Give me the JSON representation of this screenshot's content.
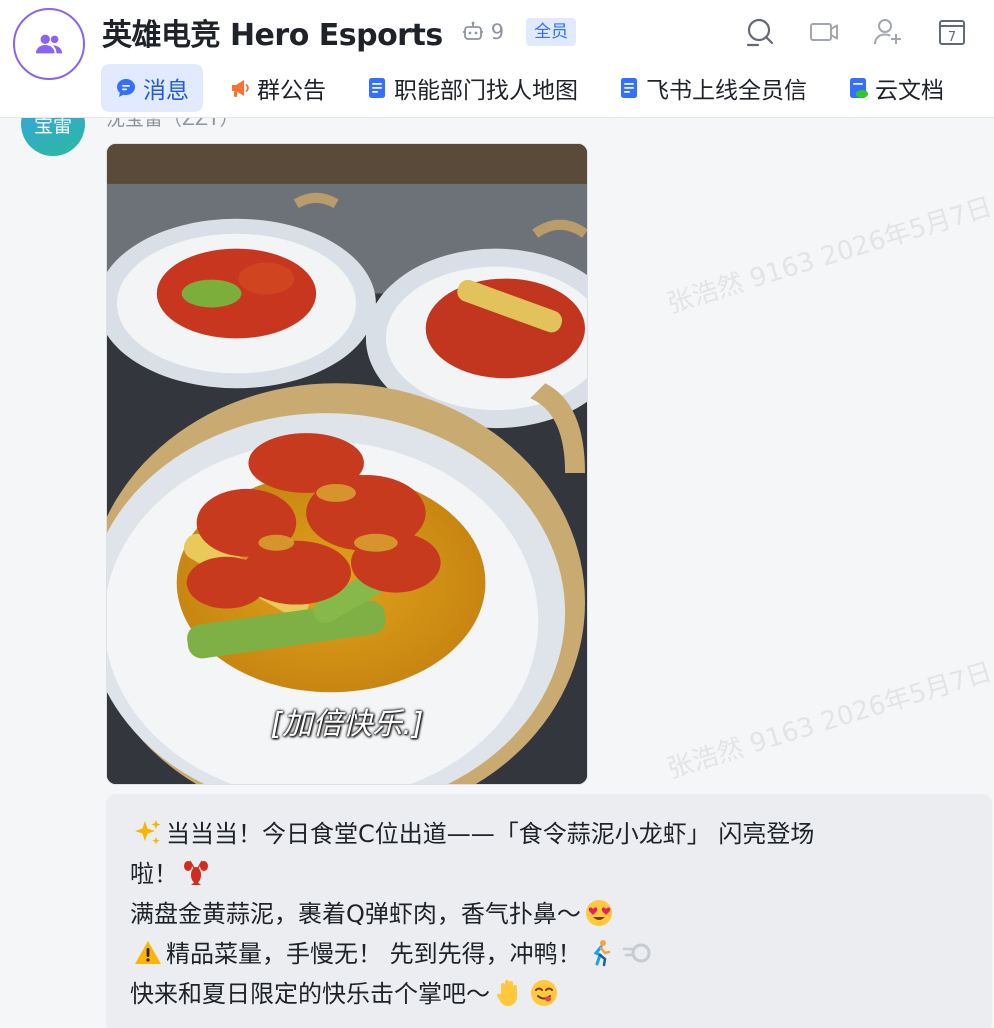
{
  "header": {
    "title": "英雄电竞 Hero Esports",
    "bot_count": "9",
    "all_badge": "全员"
  },
  "tabs": [
    {
      "label": "消息",
      "icon": "chat-bubble-icon"
    },
    {
      "label": "群公告",
      "icon": "megaphone-icon"
    },
    {
      "label": "职能部门找人地图",
      "icon": "doc-icon"
    },
    {
      "label": "飞书上线全员信",
      "icon": "doc-icon"
    },
    {
      "label": "云文档",
      "icon": "cloud-doc-icon"
    }
  ],
  "header_icons": [
    "search-icon",
    "video-call-icon",
    "add-member-icon",
    "calendar-icon"
  ],
  "calendar_day": "7",
  "message": {
    "avatar_text": "宝雷",
    "sender": "沈宝雷（ZZT）",
    "image_caption": "[加倍快乐.]",
    "lines": [
      "当当当！今日食堂C位出道——「食令蒜泥小龙虾」 闪亮登场",
      "啦！",
      "满盘金黄蒜泥，裹着Q弹虾肉，香气扑鼻～",
      "精品菜量，手慢无！ 先到先得，冲鸭！",
      "快来和夏日限定的快乐击个掌吧～"
    ]
  },
  "watermark": "张浩然 9163 2026年5月7日",
  "colors": {
    "accent": "#3370ff",
    "avatar_ring": "#8a63f0",
    "tab_active_bg": "#e1eaff",
    "chat_bg": "#f5f6f7",
    "bubble_bg": "#ebedf0"
  }
}
